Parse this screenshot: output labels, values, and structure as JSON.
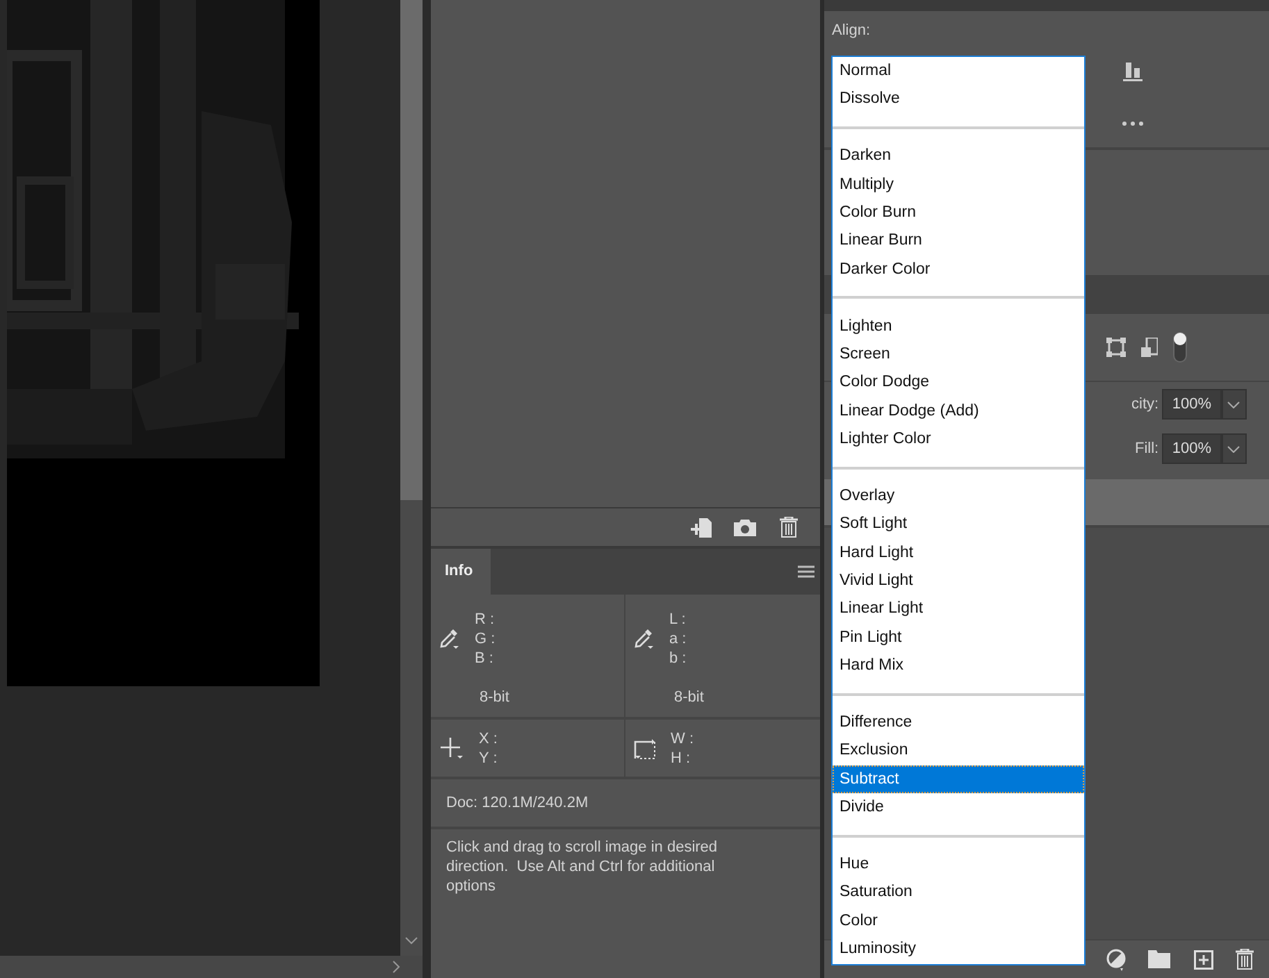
{
  "info_panel": {
    "tabs": [
      {
        "label": "Info",
        "selected": true
      }
    ],
    "color_readouts": [
      {
        "labels": [
          "R :",
          "G :",
          "B :"
        ],
        "bit_depth": "8-bit"
      },
      {
        "labels": [
          "L :",
          "a :",
          "b :"
        ],
        "bit_depth": "8-bit"
      }
    ],
    "position_readouts": [
      {
        "kind": "crosshair",
        "labels": [
          "X :",
          "Y :"
        ]
      },
      {
        "kind": "selection",
        "labels": [
          "W :",
          "H :"
        ]
      }
    ],
    "document_size": "Doc: 120.1M/240.2M",
    "hint": "Click and drag to scroll image in desired direction.  Use Alt and Ctrl for additional options"
  },
  "properties_panel": {
    "label": "Align:"
  },
  "layers_panel": {
    "opacity_label": "city:",
    "opacity": "100%",
    "fill_label": "Fill:",
    "fill": "100%"
  },
  "blend_mode_menu": {
    "groups": [
      {
        "items": [
          {
            "label": "Normal",
            "selected": false
          },
          {
            "label": "Dissolve",
            "selected": false
          }
        ]
      },
      {
        "items": [
          {
            "label": "Darken",
            "selected": false
          },
          {
            "label": "Multiply",
            "selected": false
          },
          {
            "label": "Color Burn",
            "selected": false
          },
          {
            "label": "Linear Burn",
            "selected": false
          },
          {
            "label": "Darker Color",
            "selected": false
          }
        ]
      },
      {
        "items": [
          {
            "label": "Lighten",
            "selected": false
          },
          {
            "label": "Screen",
            "selected": false
          },
          {
            "label": "Color Dodge",
            "selected": false
          },
          {
            "label": "Linear Dodge (Add)",
            "selected": false
          },
          {
            "label": "Lighter Color",
            "selected": false
          }
        ]
      },
      {
        "items": [
          {
            "label": "Overlay",
            "selected": false
          },
          {
            "label": "Soft Light",
            "selected": false
          },
          {
            "label": "Hard Light",
            "selected": false
          },
          {
            "label": "Vivid Light",
            "selected": false
          },
          {
            "label": "Linear Light",
            "selected": false
          },
          {
            "label": "Pin Light",
            "selected": false
          },
          {
            "label": "Hard Mix",
            "selected": false
          }
        ]
      },
      {
        "items": [
          {
            "label": "Difference",
            "selected": false
          },
          {
            "label": "Exclusion",
            "selected": false
          },
          {
            "label": "Subtract",
            "selected": true
          },
          {
            "label": "Divide",
            "selected": false
          }
        ]
      },
      {
        "items": [
          {
            "label": "Hue",
            "selected": false
          },
          {
            "label": "Saturation",
            "selected": false
          },
          {
            "label": "Color",
            "selected": false
          },
          {
            "label": "Luminosity",
            "selected": false
          }
        ]
      }
    ]
  }
}
